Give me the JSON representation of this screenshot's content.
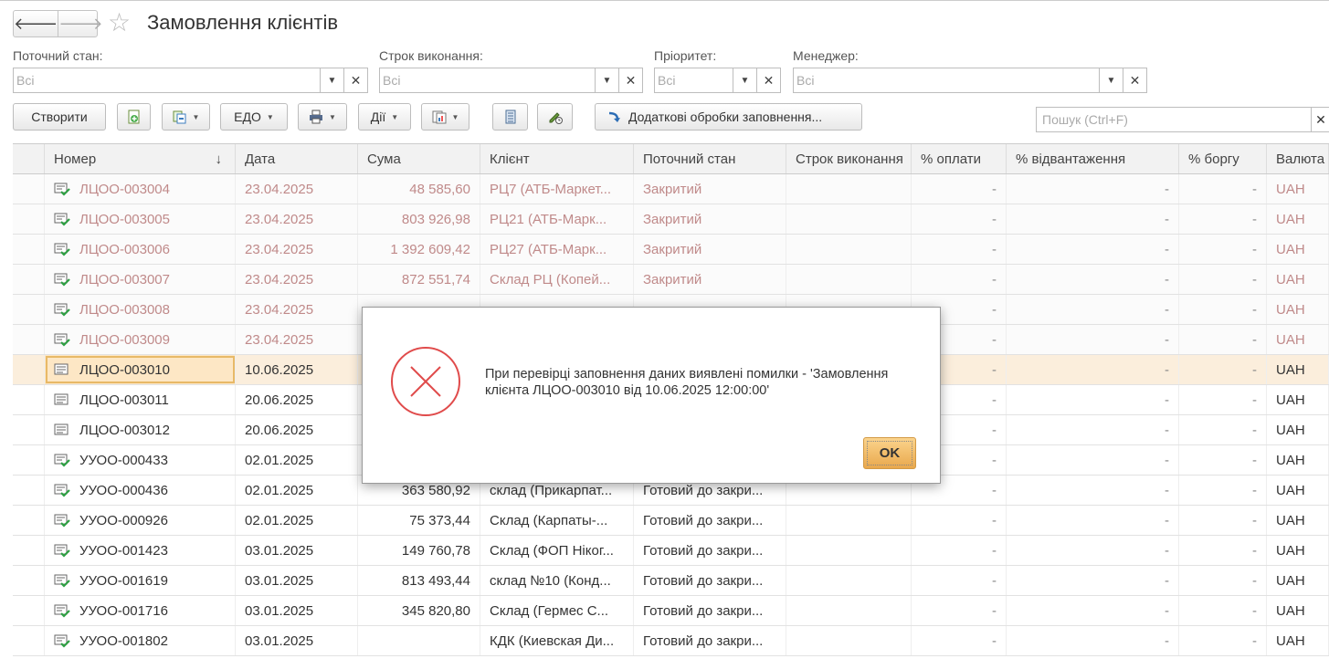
{
  "window": {
    "title": "Замовлення клієнтів"
  },
  "nav": {
    "back": "🡐",
    "forward": "🡒"
  },
  "filters": [
    {
      "label": "Поточний стан:",
      "placeholder": "Всі"
    },
    {
      "label": "Строк виконання:",
      "placeholder": "Всі"
    },
    {
      "label": "Пріоритет:",
      "placeholder": "Всі"
    },
    {
      "label": "Менеджер:",
      "placeholder": "Всі"
    }
  ],
  "toolbar": {
    "create": "Створити",
    "edo": "ЕДО",
    "actions": "Дії",
    "extra_processing": "Додаткові обробки заповнення...",
    "search_placeholder": "Пошук (Ctrl+F)"
  },
  "table": {
    "columns": [
      "Номер",
      "Дата",
      "Сума",
      "Клієнт",
      "Поточний стан",
      "Строк виконання",
      "% оплати",
      "% відвантаження",
      "% боргу",
      "Валюта"
    ],
    "rows": [
      {
        "num": "ЛЦОО-003004",
        "date": "23.04.2025",
        "sum": "48 585,60",
        "client": "РЦ7 (АТБ-Маркет...",
        "state": "Закритий",
        "p1": "-",
        "p2": "-",
        "p3": "-",
        "cur": "UAH",
        "style": "closed",
        "icon": "check"
      },
      {
        "num": "ЛЦОО-003005",
        "date": "23.04.2025",
        "sum": "803 926,98",
        "client": "РЦ21 (АТБ-Марк...",
        "state": "Закритий",
        "p1": "-",
        "p2": "-",
        "p3": "-",
        "cur": "UAH",
        "style": "closed",
        "icon": "check"
      },
      {
        "num": "ЛЦОО-003006",
        "date": "23.04.2025",
        "sum": "1 392 609,42",
        "client": "РЦ27 (АТБ-Марк...",
        "state": "Закритий",
        "p1": "-",
        "p2": "-",
        "p3": "-",
        "cur": "UAH",
        "style": "closed",
        "icon": "check"
      },
      {
        "num": "ЛЦОО-003007",
        "date": "23.04.2025",
        "sum": "872 551,74",
        "client": "Склад РЦ (Копей...",
        "state": "Закритий",
        "p1": "-",
        "p2": "-",
        "p3": "-",
        "cur": "UAH",
        "style": "closed",
        "icon": "check"
      },
      {
        "num": "ЛЦОО-003008",
        "date": "23.04.2025",
        "sum": "",
        "client": "",
        "state": "",
        "p1": "-",
        "p2": "-",
        "p3": "-",
        "cur": "UAH",
        "style": "closed",
        "icon": "check"
      },
      {
        "num": "ЛЦОО-003009",
        "date": "23.04.2025",
        "sum": "",
        "client": "",
        "state": "",
        "p1": "-",
        "p2": "-",
        "p3": "-",
        "cur": "UAH",
        "style": "closed",
        "icon": "check"
      },
      {
        "num": "ЛЦОО-003010",
        "date": "10.06.2025",
        "sum": "",
        "client": "",
        "state": "",
        "p1": "-",
        "p2": "-",
        "p3": "-",
        "cur": "UAH",
        "style": "sel",
        "icon": "doc"
      },
      {
        "num": "ЛЦОО-003011",
        "date": "20.06.2025",
        "sum": "",
        "client": "",
        "state": "",
        "p1": "-",
        "p2": "-",
        "p3": "-",
        "cur": "UAH",
        "style": "",
        "icon": "doc"
      },
      {
        "num": "ЛЦОО-003012",
        "date": "20.06.2025",
        "sum": "",
        "client": "",
        "state": "",
        "p1": "-",
        "p2": "-",
        "p3": "-",
        "cur": "UAH",
        "style": "",
        "icon": "doc"
      },
      {
        "num": "УУОО-000433",
        "date": "02.01.2025",
        "sum": "",
        "client": "",
        "state": "",
        "p1": "-",
        "p2": "-",
        "p3": "-",
        "cur": "UAH",
        "style": "",
        "icon": "check"
      },
      {
        "num": "УУОО-000436",
        "date": "02.01.2025",
        "sum": "363 580,92",
        "client": "склад (Прикарпат...",
        "state": "Готовий до закри...",
        "p1": "-",
        "p2": "-",
        "p3": "-",
        "cur": "UAH",
        "style": "",
        "icon": "check"
      },
      {
        "num": "УУОО-000926",
        "date": "02.01.2025",
        "sum": "75 373,44",
        "client": "Склад (Карпаты-...",
        "state": "Готовий до закри...",
        "p1": "-",
        "p2": "-",
        "p3": "-",
        "cur": "UAH",
        "style": "",
        "icon": "check"
      },
      {
        "num": "УУОО-001423",
        "date": "03.01.2025",
        "sum": "149 760,78",
        "client": "Склад (ФОП Ніког...",
        "state": "Готовий до закри...",
        "p1": "-",
        "p2": "-",
        "p3": "-",
        "cur": "UAH",
        "style": "",
        "icon": "check"
      },
      {
        "num": "УУОО-001619",
        "date": "03.01.2025",
        "sum": "813 493,44",
        "client": "склад №10 (Конд...",
        "state": "Готовий до закри...",
        "p1": "-",
        "p2": "-",
        "p3": "-",
        "cur": "UAH",
        "style": "",
        "icon": "check"
      },
      {
        "num": "УУОО-001716",
        "date": "03.01.2025",
        "sum": "345 820,80",
        "client": "Склад (Гермес С...",
        "state": "Готовий до закри...",
        "p1": "-",
        "p2": "-",
        "p3": "-",
        "cur": "UAH",
        "style": "",
        "icon": "check"
      },
      {
        "num": "УУОО-001802",
        "date": "03.01.2025",
        "sum": "",
        "client": "КДК (Киевская Ди...",
        "state": "Готовий до закри...",
        "p1": "-",
        "p2": "-",
        "p3": "-",
        "cur": "UAH",
        "style": "",
        "icon": "check"
      }
    ]
  },
  "dialog": {
    "message": "При перевірці заповнення даних виявлені помилки - 'Замовлення клієнта ЛЦОО-003010 від 10.06.2025 12:00:00'",
    "ok": "OK"
  },
  "colors": {
    "closed_text": "#c08a8a",
    "selected_row": "#fbeedc",
    "error_icon": "#e04b4b",
    "ok_button": "#f0b95e"
  }
}
